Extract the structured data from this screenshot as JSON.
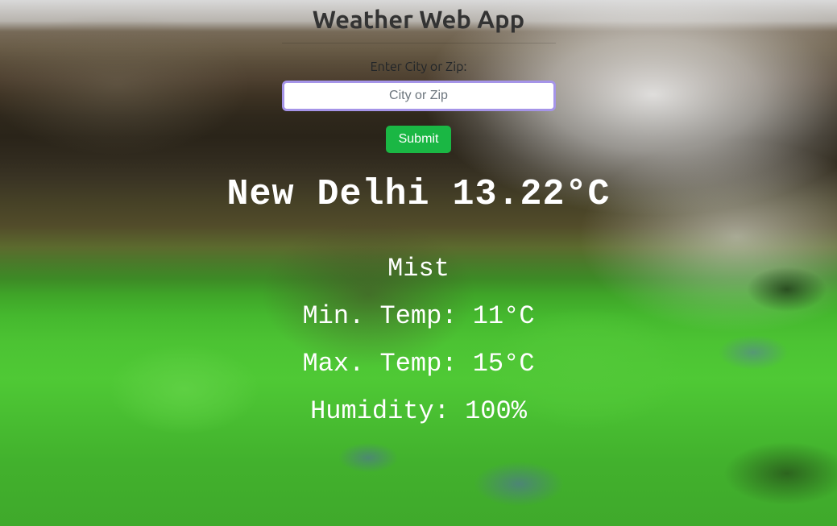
{
  "app": {
    "title": "Weather Web App"
  },
  "form": {
    "label": "Enter City or Zip:",
    "placeholder": "City or Zip",
    "submit_label": "Submit"
  },
  "weather": {
    "headline": "New Delhi 13.22°C",
    "condition": "Mist",
    "min_temp_line": "Min. Temp: 11°C",
    "max_temp_line": "Max. Temp: 15°C",
    "humidity_line": "Humidity: 100%"
  }
}
